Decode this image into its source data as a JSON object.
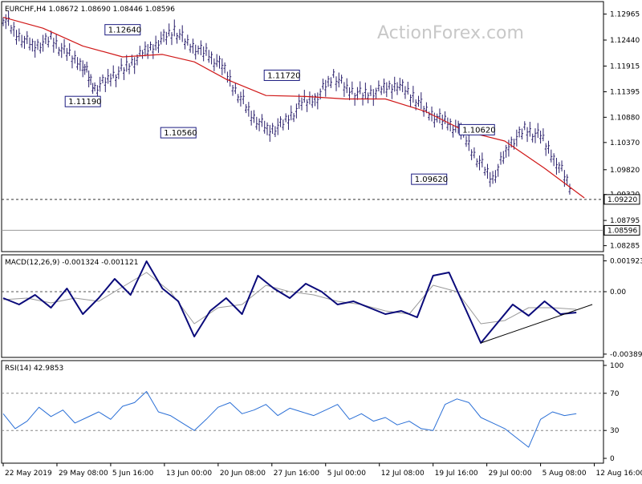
{
  "chart_data": [
    {
      "type": "line",
      "title": "EURCHF,H4  1.08672 1.08690 1.08446 1.08596",
      "watermark": "ActionForex.com",
      "y_ticks": [
        "1.12965",
        "1.12440",
        "1.11915",
        "1.11395",
        "1.10880",
        "1.10370",
        "1.09820",
        "1.09320",
        "1.08795",
        "1.08285"
      ],
      "ylim": [
        1.0823,
        1.1312
      ],
      "series": [
        {
          "name": "",
          "color": "#2a1f6b",
          "kind": "price_bars",
          "x": [
            0,
            4,
            8,
            12,
            16,
            20,
            23,
            27,
            31,
            35,
            39,
            43,
            47,
            51,
            55,
            59,
            63,
            67,
            71,
            75,
            79,
            83,
            87,
            91,
            95,
            99,
            103,
            107,
            111,
            115,
            119,
            123,
            127,
            131,
            135,
            139,
            143
          ],
          "values": [
            1.129,
            1.125,
            1.123,
            1.1245,
            1.1215,
            1.1195,
            1.1145,
            1.1168,
            1.1188,
            1.1215,
            1.124,
            1.1264,
            1.1232,
            1.1216,
            1.119,
            1.1135,
            1.1085,
            1.106,
            1.1078,
            1.1115,
            1.113,
            1.1172,
            1.114,
            1.1132,
            1.1142,
            1.1155,
            1.113,
            1.1095,
            1.1078,
            1.106,
            1.1005,
            1.0962,
            1.103,
            1.1062,
            1.1048,
            1.0998,
            1.094
          ]
        },
        {
          "name": "",
          "color": "#d01818",
          "kind": "moving_average",
          "x": [
            0,
            10,
            20,
            30,
            40,
            48,
            56,
            66,
            76,
            86,
            96,
            106,
            116,
            126,
            136,
            146
          ],
          "values": [
            1.129,
            1.1268,
            1.1232,
            1.121,
            1.1215,
            1.12,
            1.1165,
            1.1132,
            1.113,
            1.1125,
            1.1125,
            1.11,
            1.106,
            1.104,
            1.0985,
            1.0925
          ]
        }
      ],
      "callouts": [
        {
          "label": "1.12640",
          "value": 1.1264
        },
        {
          "label": "1.11190",
          "value": 1.1119
        },
        {
          "label": "1.10560",
          "value": 1.1056
        },
        {
          "label": "1.11720",
          "value": 1.1172
        },
        {
          "label": "1.09620",
          "value": 1.0962
        },
        {
          "label": "1.10620",
          "value": 1.1062
        }
      ],
      "reference_lines": [
        {
          "label": "1.09220",
          "value": 1.0922,
          "style": "dashed"
        },
        {
          "label": "1.08596",
          "value": 1.08596,
          "style": "solid"
        }
      ]
    },
    {
      "type": "line",
      "title": "MACD(12,26,9) -0.001324 -0.001121",
      "y_ticks": [
        "0.001923",
        "0.00",
        "-0.003896"
      ],
      "ylim": [
        -0.0039,
        0.0021
      ],
      "zero_line": "dashed",
      "series": [
        {
          "name": "",
          "color": "#0a0a7a",
          "kind": "macd",
          "x": [
            0,
            4,
            8,
            12,
            16,
            20,
            24,
            28,
            32,
            36,
            40,
            44,
            48,
            52,
            56,
            60,
            64,
            68,
            72,
            76,
            80,
            84,
            88,
            92,
            96,
            100,
            104,
            108,
            112,
            116,
            120,
            124,
            128,
            132,
            136,
            140,
            144
          ],
          "values": [
            -0.0004,
            -0.0008,
            -0.0002,
            -0.001,
            0.0002,
            -0.0014,
            -0.0004,
            0.0008,
            -0.0002,
            0.0019,
            0.0002,
            -0.0006,
            -0.0028,
            -0.0012,
            -0.0004,
            -0.0014,
            0.001,
            0.0002,
            -0.0004,
            0.0005,
            0.0,
            -0.0008,
            -0.0006,
            -0.001,
            -0.0014,
            -0.0012,
            -0.0016,
            0.001,
            0.0012,
            -0.001,
            -0.0032,
            -0.002,
            -0.0008,
            -0.0015,
            -0.0006,
            -0.0014,
            -0.0013
          ]
        },
        {
          "name": "",
          "color": "#9a9a9a",
          "kind": "signal",
          "x": [
            0,
            6,
            12,
            18,
            24,
            30,
            36,
            42,
            48,
            54,
            60,
            66,
            72,
            78,
            84,
            90,
            96,
            102,
            108,
            114,
            120,
            126,
            132,
            138,
            144
          ],
          "values": [
            -0.0005,
            -0.0004,
            -0.0007,
            -0.0004,
            -0.0006,
            0.0003,
            0.0012,
            0.0,
            -0.002,
            -0.001,
            -0.0008,
            0.0004,
            0.0,
            -0.0002,
            -0.0006,
            -0.0008,
            -0.0012,
            -0.0014,
            0.0004,
            0.0,
            -0.002,
            -0.0018,
            -0.001,
            -0.001,
            -0.0011
          ]
        }
      ],
      "trendline": {
        "x": [
          120,
          148
        ],
        "values": [
          -0.0032,
          -0.0008
        ]
      }
    },
    {
      "type": "line",
      "title": "RSI(14) 42.9853",
      "y_ticks": [
        "100",
        "70",
        "30",
        "0"
      ],
      "ylim": [
        0,
        100
      ],
      "levels": [
        70,
        30
      ],
      "series": [
        {
          "name": "",
          "color": "#2a6fd6",
          "kind": "rsi",
          "x": [
            0,
            3,
            6,
            9,
            12,
            15,
            18,
            21,
            24,
            27,
            30,
            33,
            36,
            39,
            42,
            45,
            48,
            51,
            54,
            57,
            60,
            63,
            66,
            69,
            72,
            75,
            78,
            81,
            84,
            87,
            90,
            93,
            96,
            99,
            102,
            105,
            108,
            111,
            114,
            117,
            120,
            123,
            126,
            129,
            132,
            135,
            138,
            141,
            144
          ],
          "values": [
            48,
            32,
            40,
            55,
            45,
            52,
            38,
            44,
            50,
            42,
            56,
            60,
            72,
            50,
            46,
            38,
            30,
            42,
            55,
            60,
            48,
            52,
            58,
            46,
            54,
            50,
            46,
            52,
            58,
            42,
            48,
            40,
            44,
            36,
            40,
            32,
            30,
            58,
            64,
            60,
            44,
            38,
            32,
            22,
            12,
            42,
            50,
            46,
            48
          ]
        }
      ]
    }
  ],
  "x_axis": {
    "tick_labels": [
      "22 May 2019",
      "29 May 08:00",
      "5 Jun 16:00",
      "13 Jun 00:00",
      "20 Jun 08:00",
      "27 Jun 16:00",
      "5 Jul 00:00",
      "12 Jul 08:00",
      "19 Jul 16:00",
      "29 Jul 00:00",
      "5 Aug 08:00",
      "12 Aug 16:00"
    ],
    "tick_x": [
      0,
      13.5,
      27,
      40.5,
      54,
      67.5,
      81,
      94.5,
      108,
      121.5,
      135,
      148.5
    ]
  }
}
